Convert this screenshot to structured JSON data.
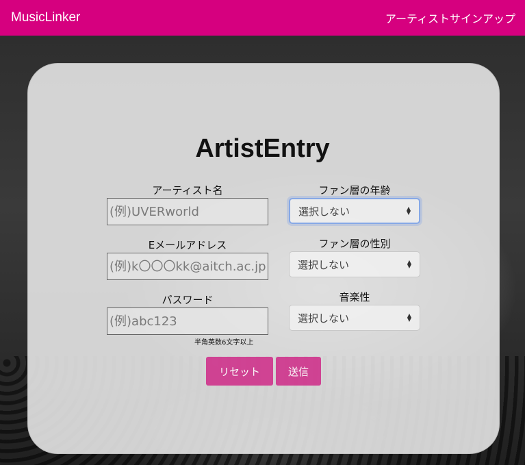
{
  "navbar": {
    "brand": "MusicLinker",
    "link": "アーティストサインアップ"
  },
  "form": {
    "title": "ArtistEntry",
    "artist_name": {
      "label": "アーティスト名",
      "placeholder": "(例)UVERworld"
    },
    "email": {
      "label": "Eメールアドレス",
      "placeholder": "(例)k〇〇〇kk@aitch.ac.jp"
    },
    "password": {
      "label": "パスワード",
      "placeholder": "(例)abc123",
      "hint": "半角英数6文字以上"
    },
    "fan_age": {
      "label": "ファン層の年齢",
      "selected": "選択しない"
    },
    "fan_gender": {
      "label": "ファン層の性別",
      "selected": "選択しない"
    },
    "music": {
      "label": "音楽性",
      "selected": "選択しない"
    },
    "reset_label": "リセット",
    "submit_label": "送信"
  },
  "colors": {
    "brand": "#d6007f",
    "button": "#cf2f8a"
  }
}
